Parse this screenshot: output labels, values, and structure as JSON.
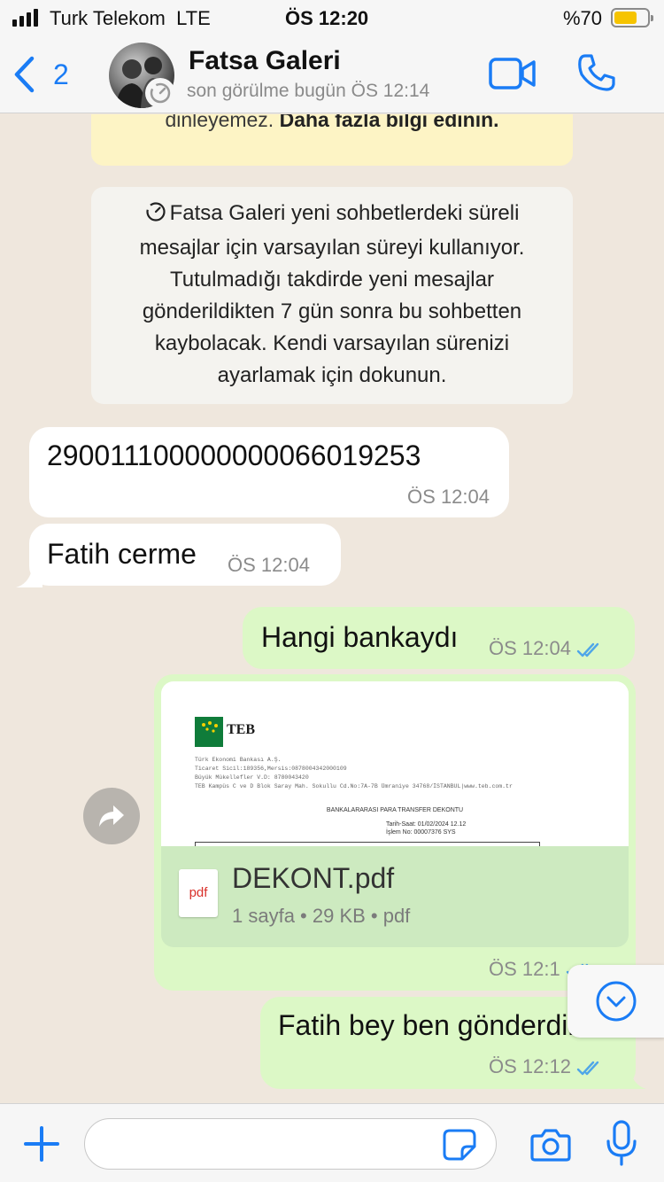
{
  "status_bar": {
    "carrier": "Turk Telekom",
    "network": "LTE",
    "time": "ÖS 12:20",
    "battery_percent": "%70",
    "battery_level": 0.7,
    "battery_color": "#f6c400"
  },
  "header": {
    "back_count": "2",
    "contact_name": "Fatsa Galeri",
    "last_seen": "son görülme bugün ÖS 12:14",
    "accent_color": "#1a7cf5"
  },
  "chat": {
    "info_note": {
      "text": "dinleyemez.",
      "link": "Daha fazla bilgi edinin."
    },
    "system_note": {
      "lines": [
        "Fatsa Galeri yeni sohbetlerdeki süreli",
        "mesajlar için varsayılan süreyi kullanıyor.",
        "Tutulmadığı takdirde yeni mesajlar",
        "gönderildikten 7 gün sonra bu sohbetten",
        "kaybolacak. Kendi varsayılan sürenizi",
        "ayarlamak için dokunun."
      ]
    },
    "messages": [
      {
        "direction": "in",
        "text": "290011100000000066019253",
        "time": "ÖS 12:04"
      },
      {
        "direction": "in",
        "text": "Fatih cerme",
        "time": "ÖS 12:04"
      },
      {
        "direction": "out",
        "text": "Hangi bankaydı",
        "time": "ÖS 12:04",
        "status": "read"
      },
      {
        "direction": "out",
        "type": "document",
        "time": "ÖS 12:1",
        "status": "read",
        "document": {
          "file_name": "DEKONT.pdf",
          "icon_label": "pdf",
          "meta": "1 sayfa • 29 KB • pdf",
          "preview": {
            "bank_logo_text": "TEB",
            "lines": [
              "Türk Ekonomi Bankası A.Ş.",
              "Ticaret Sicil:189356,Mersis:0878004342000109",
              "Büyük Mükellefler V.D: 8780043420",
              "TEB Kampüs C ve D Blok Saray Mah. Sokullu Cd.No:7A-7B Ümraniye 34768/İSTANBUL|www.teb.com.tr"
            ],
            "title": "BANKALARARASI PARA TRANSFER DEKONTU",
            "date_line": "Tarih-Saat: 01/02/2024 12.12",
            "txn_line": "İşlem No:    00007376   SYS"
          }
        }
      },
      {
        "direction": "out",
        "text": "Fatih bey ben gönderdim",
        "time": "ÖS 12:12",
        "status": "read"
      }
    ],
    "bubble_colors": {
      "incoming": "#ffffff",
      "outgoing": "#dcf8c6"
    },
    "read_tick_color": "#4fa6e8"
  },
  "input_bar": {
    "placeholder": ""
  },
  "icons": {
    "signal": "signal-bars-icon",
    "battery": "battery-icon",
    "back": "chevron-left-icon",
    "timer": "disappearing-timer-icon",
    "video": "video-camera-icon",
    "phone": "phone-icon",
    "forward": "forward-icon",
    "scroll_down": "chevron-down-circle-icon",
    "attach": "plus-icon",
    "sticker": "sticker-icon",
    "camera": "camera-icon",
    "mic": "microphone-icon",
    "read_ticks": "double-check-icon"
  }
}
